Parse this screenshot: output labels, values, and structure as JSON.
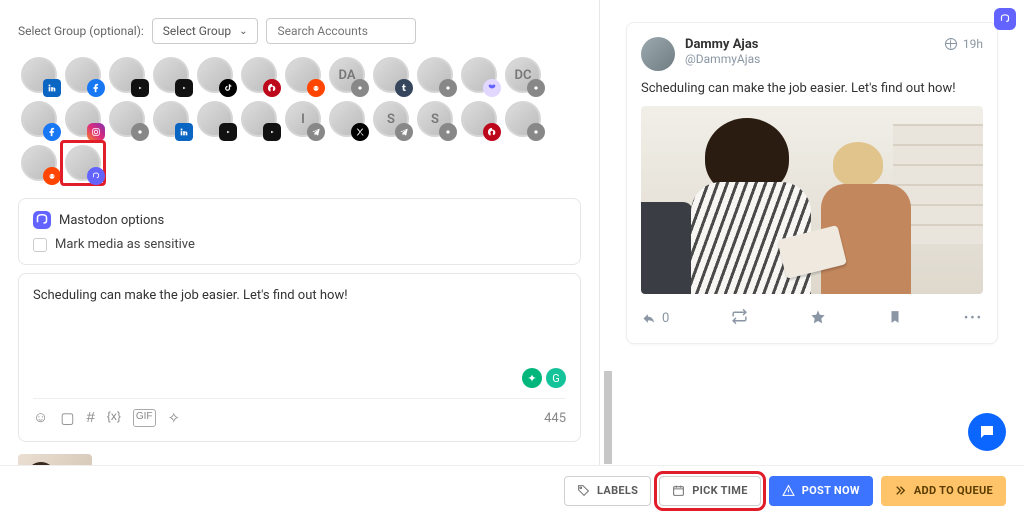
{
  "filter": {
    "label": "Select Group (optional):",
    "select_group": "Select Group",
    "search_placeholder": "Search Accounts"
  },
  "accounts": [
    {
      "initials": "",
      "net": "linkedin"
    },
    {
      "initials": "",
      "net": "facebook"
    },
    {
      "initials": "",
      "net": "youtube"
    },
    {
      "initials": "",
      "net": "youtube"
    },
    {
      "initials": "",
      "net": "tiktok"
    },
    {
      "initials": "",
      "net": "pinterest"
    },
    {
      "initials": "",
      "net": "reddit"
    },
    {
      "initials": "DA",
      "net": "grey"
    },
    {
      "initials": "",
      "net": "tumblr"
    },
    {
      "initials": "",
      "net": "grey"
    },
    {
      "initials": "",
      "net": "bluesky"
    },
    {
      "initials": "DC",
      "net": "grey"
    },
    {
      "initials": "",
      "net": "facebook"
    },
    {
      "initials": "",
      "net": "insta"
    },
    {
      "initials": "",
      "net": "grey"
    },
    {
      "initials": "",
      "net": "linkedin"
    },
    {
      "initials": "",
      "net": "youtube"
    },
    {
      "initials": "",
      "net": "youtube"
    },
    {
      "initials": "I",
      "net": "telegram"
    },
    {
      "initials": "",
      "net": "xt"
    },
    {
      "initials": "S",
      "net": "telegram"
    },
    {
      "initials": "S",
      "net": "grey"
    },
    {
      "initials": "",
      "net": "pinterest"
    },
    {
      "initials": "",
      "net": "grey"
    },
    {
      "initials": "",
      "net": "reddit"
    },
    {
      "initials": "",
      "net": "mastodon",
      "selected": true
    }
  ],
  "options": {
    "header": "Mastodon options",
    "mark_sensitive": "Mark media as sensitive"
  },
  "compose": {
    "text": "Scheduling can make the job easier. Let's find out how!",
    "count": "445"
  },
  "preview": {
    "name": "Dammy Ajas",
    "handle": "@DammyAjas",
    "time": "19h",
    "body": "Scheduling can make the job easier. Let's find out how!",
    "replies": "0"
  },
  "bottom": {
    "labels": "LABELS",
    "pick_time": "PICK TIME",
    "post_now": "POST NOW",
    "add_queue": "ADD TO QUEUE"
  }
}
